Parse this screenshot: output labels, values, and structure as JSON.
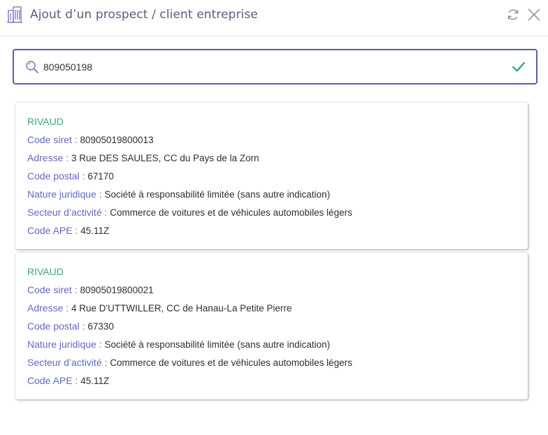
{
  "header": {
    "title": "Ajout d’un prospect / client entreprise"
  },
  "search": {
    "value": "809050198",
    "placeholder": ""
  },
  "colors": {
    "accent": "#5a5fa8",
    "label": "#6468c0",
    "company_name": "#3aa876",
    "check": "#2aa36b"
  },
  "results": [
    {
      "name": "RIVAUD",
      "siret_label": "Code siret",
      "siret": "80905019800013",
      "address_label": "Adresse",
      "address": "3 Rue DES SAULES, CC du Pays de la Zorn",
      "postal_label": "Code postal",
      "postal": "67170",
      "legal_label": "Nature juridique",
      "legal": "Société à responsabilité limitée (sans autre indication)",
      "sector_label": "Secteur d’activité",
      "sector": "Commerce de voitures et de véhicules automobiles légers",
      "ape_label": "Code APE",
      "ape": "45.11Z"
    },
    {
      "name": "RIVAUD",
      "siret_label": "Code siret",
      "siret": "80905019800021",
      "address_label": "Adresse",
      "address": "4 Rue D'UTTWILLER, CC de Hanau-La Petite Pierre",
      "postal_label": "Code postal",
      "postal": "67330",
      "legal_label": "Nature juridique",
      "legal": "Société à responsabilité limitée (sans autre indication)",
      "sector_label": "Secteur d’activité",
      "sector": "Commerce de voitures et de véhicules automobiles légers",
      "ape_label": "Code APE",
      "ape": "45.11Z"
    }
  ]
}
